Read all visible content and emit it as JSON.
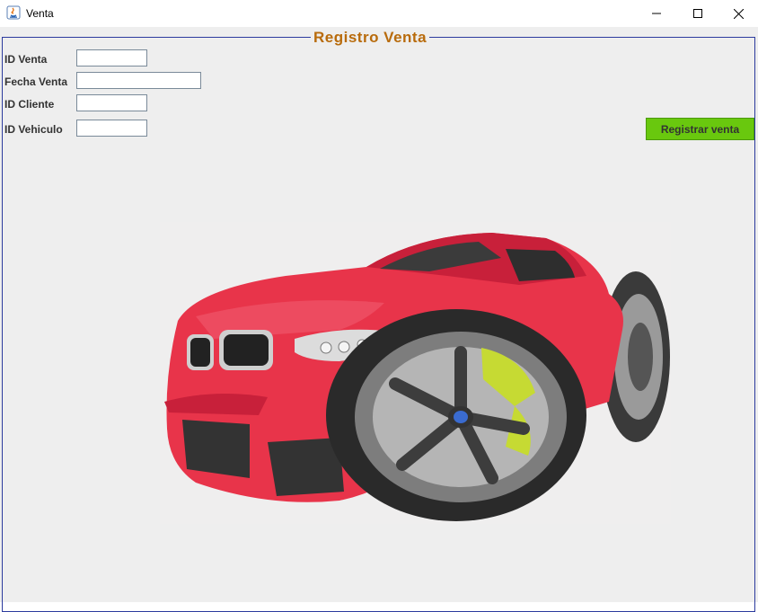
{
  "window": {
    "title": "Venta"
  },
  "form": {
    "legend": "Registro Venta",
    "fields": [
      {
        "label": "ID Venta",
        "value": ""
      },
      {
        "label": "Fecha Venta",
        "value": ""
      },
      {
        "label": "ID Cliente",
        "value": ""
      },
      {
        "label": "ID Vehiculo",
        "value": ""
      }
    ],
    "submit_label": "Registrar venta"
  },
  "colors": {
    "legend": "#b86b0c",
    "button": "#69c80e",
    "border": "#2c3b9e",
    "car_body": "#e8344a"
  },
  "icons": [
    "java-app-icon",
    "minimize-icon",
    "maximize-icon",
    "close-icon"
  ]
}
